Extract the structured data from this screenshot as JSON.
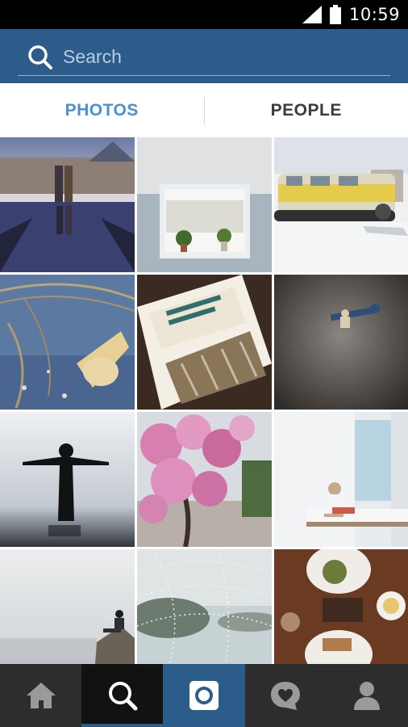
{
  "status_bar": {
    "time": "10:59",
    "icons": [
      "signal-icon",
      "battery-icon"
    ]
  },
  "search": {
    "placeholder": "Search",
    "icon": "search-icon"
  },
  "tabs": [
    {
      "label": "PHOTOS",
      "active": true
    },
    {
      "label": "PEOPLE",
      "active": false
    }
  ],
  "grid": {
    "photos": [
      {
        "subject": "couple-louvre-reflection"
      },
      {
        "subject": "window-plants"
      },
      {
        "subject": "yellow-snow-van"
      },
      {
        "subject": "lamp-wires"
      },
      {
        "subject": "glasses-box"
      },
      {
        "subject": "toy-figure-ground"
      },
      {
        "subject": "silhouette-fog"
      },
      {
        "subject": "cherry-blossoms"
      },
      {
        "subject": "man-on-bed"
      },
      {
        "subject": "person-on-rock"
      },
      {
        "subject": "dewy-web-lake"
      },
      {
        "subject": "food-table"
      }
    ]
  },
  "bottom_nav": {
    "items": [
      {
        "icon": "home-icon"
      },
      {
        "icon": "explore-search-icon",
        "selected": true
      },
      {
        "icon": "camera-icon"
      },
      {
        "icon": "activity-heart-icon"
      },
      {
        "icon": "profile-icon"
      }
    ]
  },
  "colors": {
    "header_blue": "#2b5c8a",
    "active_tab": "#4a90d2",
    "nav_bg": "#2d2d2d"
  }
}
